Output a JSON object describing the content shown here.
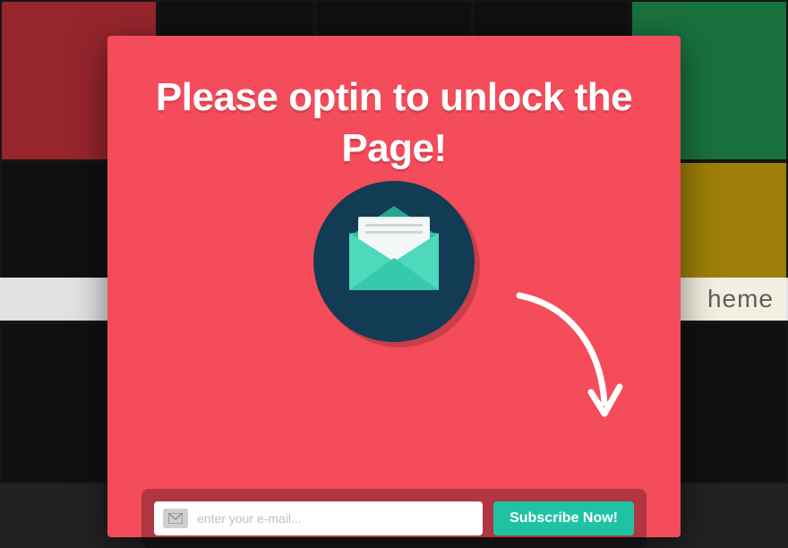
{
  "modal": {
    "headline": "Please optin to unlock the Page!",
    "form": {
      "placeholder": "enter your e-mail...",
      "button_label": "Subscribe Now!"
    }
  },
  "background": {
    "midband_text": "heme"
  },
  "colors": {
    "modal_bg": "#f44c5b",
    "cta_bg": "#1fc3a3",
    "envelope_circle": "#123c53"
  }
}
